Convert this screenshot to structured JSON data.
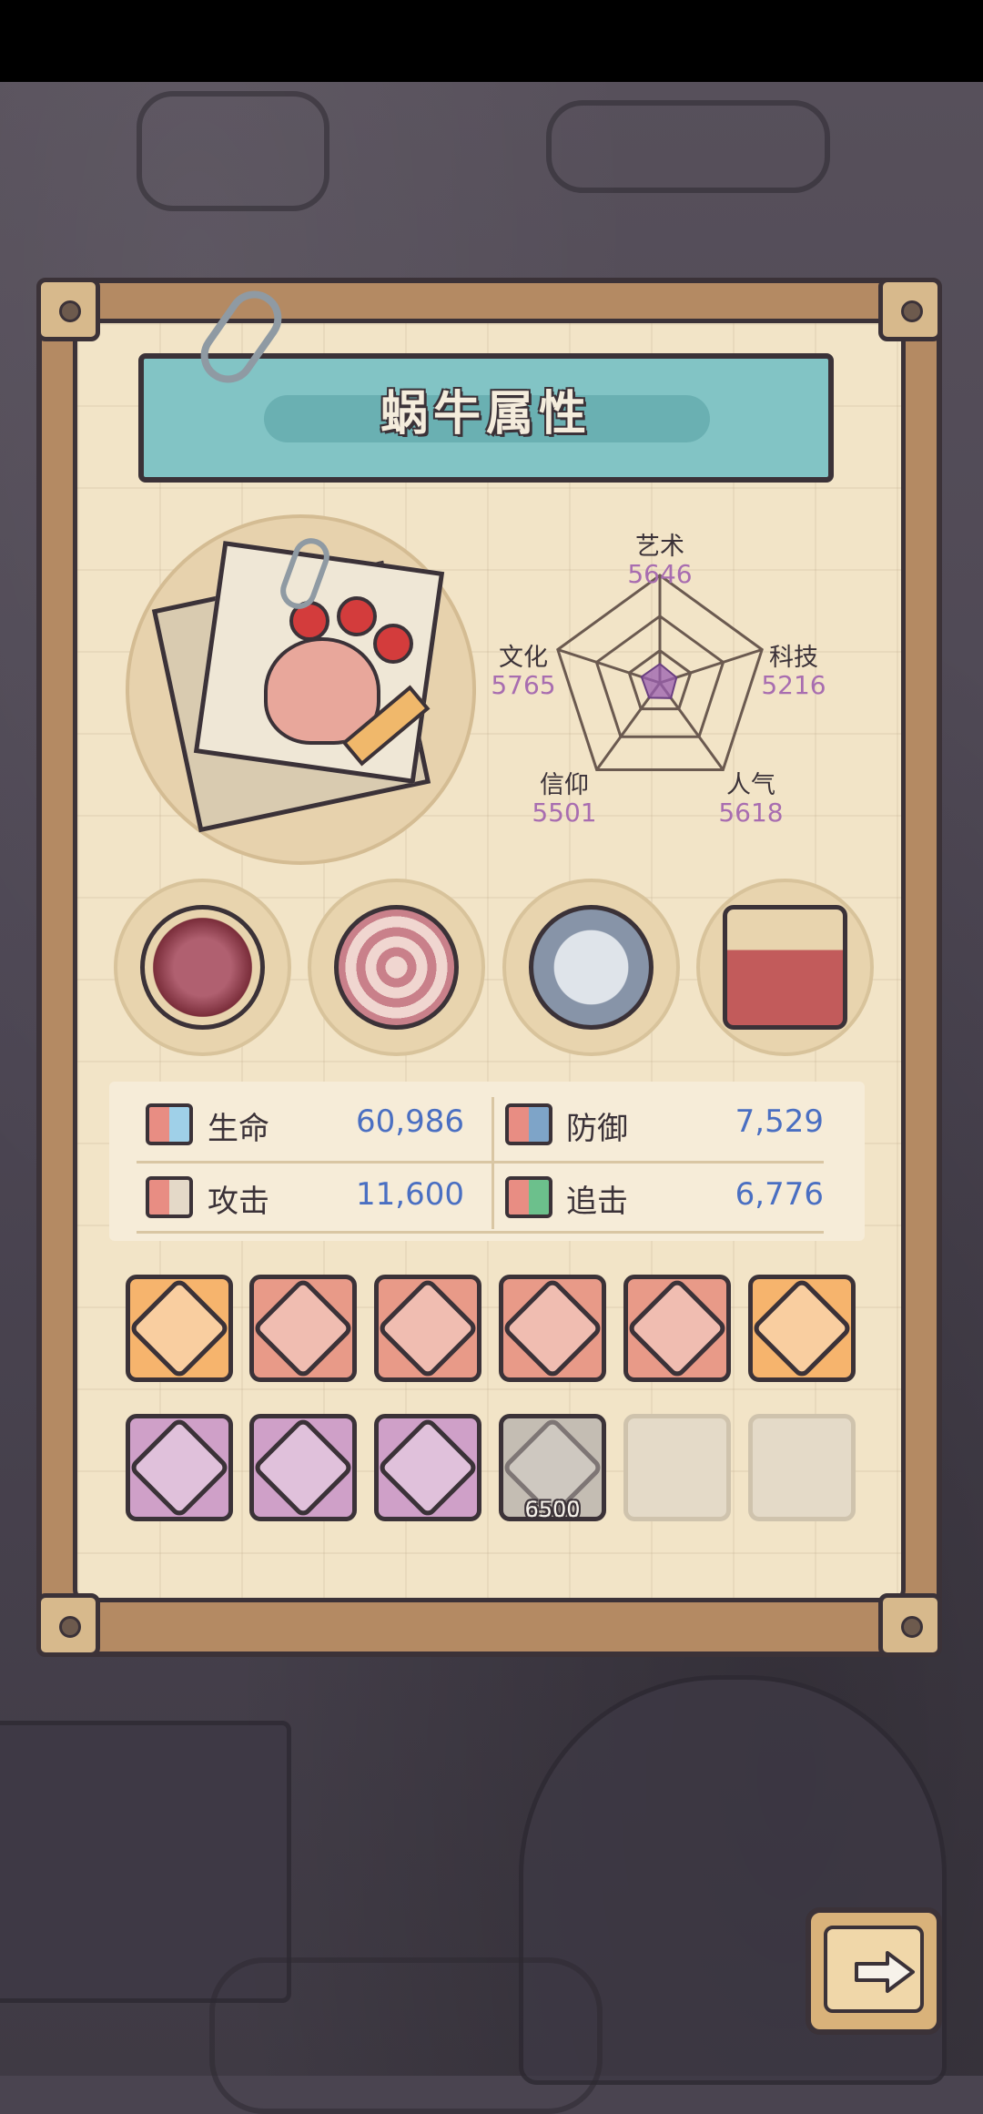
{
  "title": "蜗牛属性",
  "radar": {
    "stats": [
      {
        "label": "艺术",
        "value": "5646",
        "amount": 5646
      },
      {
        "label": "科技",
        "value": "5216",
        "amount": 5216
      },
      {
        "label": "人气",
        "value": "5618",
        "amount": 5618
      },
      {
        "label": "信仰",
        "value": "5501",
        "amount": 5501
      },
      {
        "label": "文化",
        "value": "5765",
        "amount": 5765
      }
    ]
  },
  "skills": [
    "tentacle-ring-icon",
    "shell-icon",
    "compass-icon",
    "potion-crate-icon"
  ],
  "attributes": {
    "life": {
      "label": "生命",
      "value": "60,986"
    },
    "defense": {
      "label": "防御",
      "value": "7,529"
    },
    "attack": {
      "label": "攻击",
      "value": "11,600"
    },
    "chase": {
      "label": "追击",
      "value": "6,776"
    }
  },
  "equipment": {
    "row1": [
      {
        "icon": "chain-trap-icon",
        "rarity": "orange"
      },
      {
        "icon": "dagger-icon",
        "rarity": "red"
      },
      {
        "icon": "bracer-icon",
        "rarity": "red"
      },
      {
        "icon": "blue-sword-icon",
        "rarity": "red"
      },
      {
        "icon": "blaster-icon",
        "rarity": "red"
      },
      {
        "icon": "crossed-swords-icon",
        "rarity": "orange"
      }
    ],
    "row2": [
      {
        "icon": "knife-icon",
        "rarity": "purple"
      },
      {
        "icon": "pickaxe-icon",
        "rarity": "purple"
      },
      {
        "icon": "armor-icon",
        "rarity": "purple"
      },
      {
        "icon": "scroll-icon",
        "rarity": "grey",
        "cost": "6500"
      },
      {
        "icon": "empty-slot",
        "rarity": "empty"
      },
      {
        "icon": "empty-slot",
        "rarity": "empty"
      }
    ]
  },
  "colors": {
    "panel": "#f2e4c7",
    "title_plate": "#82c4c5",
    "stat_value": "#4a6fc2",
    "radar_value": "#a86db0"
  },
  "next_button": "arrow-right-icon"
}
